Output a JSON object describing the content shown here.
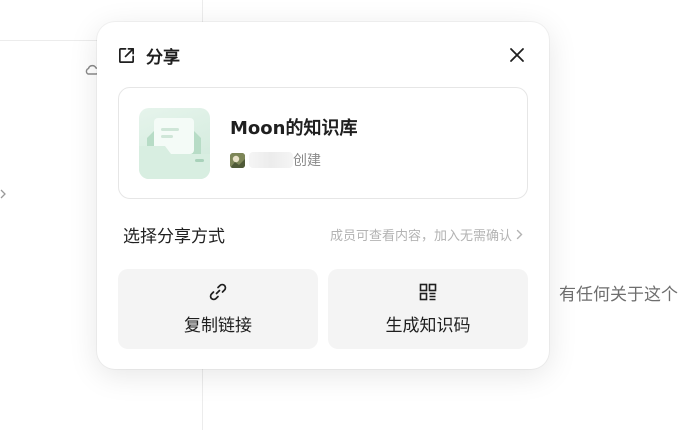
{
  "background": {
    "right_text": "有任何关于这个"
  },
  "dialog": {
    "title": "分享",
    "title_icon": "share-icon",
    "close_icon": "close-icon",
    "knowledge_base": {
      "name": "Moon的知识库",
      "created_suffix": "创建"
    },
    "share_mode": {
      "label": "选择分享方式",
      "value": "成员可查看内容，加入无需确认",
      "chevron_icon": "chevron-right-icon"
    },
    "actions": [
      {
        "label": "复制链接",
        "icon": "link-icon"
      },
      {
        "label": "生成知识码",
        "icon": "qr-code-icon"
      }
    ]
  },
  "colors": {
    "cover_green": "#cfe9da",
    "button_bg": "#f4f4f4",
    "muted_text": "#b3b3b3"
  }
}
